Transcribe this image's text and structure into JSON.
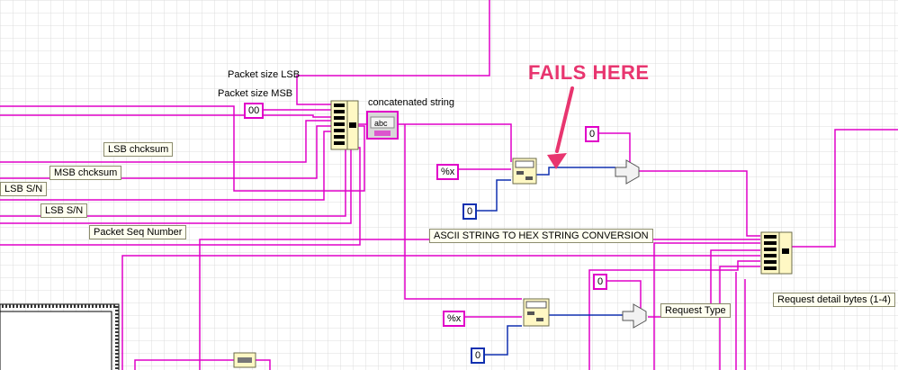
{
  "annotation": {
    "fails_text": "FAILS HERE",
    "arrow_color": "#e8356f"
  },
  "labels": {
    "packet_size_lsb": "Packet size LSB",
    "packet_size_msb": "Packet size MSB",
    "concatenated_string": "concatenated string",
    "lsb_chcksum": "LSB chcksum",
    "msb_chcksum": "MSB chcksum",
    "lsb_sn_1": "LSB S/N",
    "lsb_sn_2": "LSB S/N",
    "packet_seq_number": "Packet Seq Number",
    "ascii_to_hex": "ASCII STRING TO HEX STRING CONVERSION",
    "request_type": "Request Type",
    "request_detail_bytes": "Request detail bytes (1-4)"
  },
  "constants": {
    "hex_00": "00",
    "format_x_1": "%x",
    "format_x_2": "%x",
    "zero_blue_1": "0",
    "zero_blue_2": "0",
    "zero_pink_1": "0",
    "zero_pink_2": "0"
  },
  "nodes": {
    "concat_display": "abc"
  },
  "colors": {
    "grid": "#dcdcdc",
    "string_wire": "#e000c8",
    "numeric_wire": "#1030b0",
    "node_fill": "#fff8c4"
  }
}
